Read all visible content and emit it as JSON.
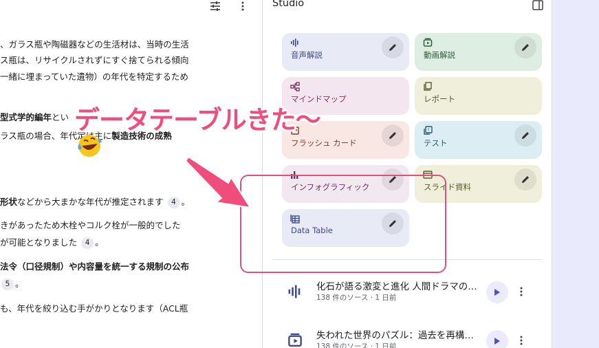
{
  "left_panel": {
    "lines": [
      "、ガラス瓶や陶磁器などの生活材は、当時の生活",
      "ス瓶は、リサイクルされずにすぐ捨てられる傾向",
      "一緒に埋まっていた遺物）の年代を特定するため"
    ],
    "line4_bold": "型式学的編年",
    "line4_rest": "とい",
    "line5_pre": "ラス瓶の場合、年代",
    "line5_mid": "定は主に",
    "line5_bold": "製造技術の成熟",
    "line6_bold": "形状",
    "line6_rest": "などから大まかな年代が推定されます",
    "line6_cite": "4",
    "line7": "きがあったため木栓やコルク栓が一般的でした",
    "line8_rest": "能となりました",
    "line8_pre": "が可",
    "line8_cite": "4",
    "line9_bold": "法令（口径規制）や内容量を統一する規制の公布",
    "line10_cite": "5",
    "line10_rest": "。",
    "line11": "も、年代を絞り込む手がかりとなります（ACL瓶"
  },
  "studio": {
    "title": "Studio",
    "tiles": [
      {
        "label": "音声解説",
        "bg": "#e8eaf6",
        "fg": "#3c4a8c",
        "icon": "audio-wave-icon",
        "edit": true
      },
      {
        "label": "動画解説",
        "bg": "#dfeee2",
        "fg": "#2f5d3a",
        "icon": "video-icon",
        "edit": true
      },
      {
        "label": "マインドマップ",
        "bg": "#f3e6ee",
        "fg": "#7a3a63",
        "icon": "mindmap-icon",
        "edit": false
      },
      {
        "label": "レポート",
        "bg": "#efefdc",
        "fg": "#5a5a2d",
        "icon": "report-icon",
        "edit": false
      },
      {
        "label": "フラッシュ カード",
        "bg": "#f8e7e3",
        "fg": "#7a3b2f",
        "icon": "flashcard-icon",
        "edit": true
      },
      {
        "label": "テスト",
        "bg": "#ddedf4",
        "fg": "#2b5a6e",
        "icon": "quiz-icon",
        "edit": true
      },
      {
        "label": "インフォグラフィック",
        "bg": "#f2e8f0",
        "fg": "#6e2f63",
        "icon": "infographic-icon",
        "edit": true
      },
      {
        "label": "スライド資料",
        "bg": "#efefdc",
        "fg": "#5a5a2d",
        "icon": "slides-icon",
        "edit": true
      },
      {
        "label": "Data Table",
        "bg": "#e8eaf6",
        "fg": "#3c4a8c",
        "icon": "table-icon",
        "edit": true
      }
    ],
    "outputs": [
      {
        "title": "化石が語る激変と進化 人間ドラマの…",
        "meta": "138 件のソース · 1 日前",
        "icon": "audio-wave-icon"
      },
      {
        "title": "失われた世界のパズル：過去を再構…",
        "meta": "138 件のソース · 1 日前",
        "icon": "video-icon"
      }
    ]
  },
  "annotation": {
    "text": "データテーブルきた〜",
    "color": "#ef4d7c"
  }
}
